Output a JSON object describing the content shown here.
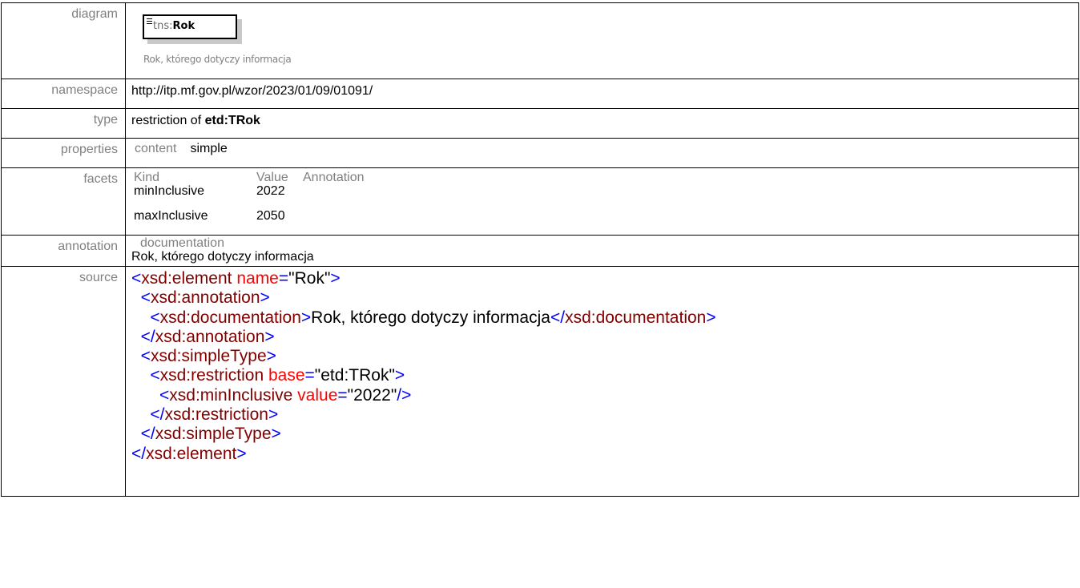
{
  "rows": {
    "diagram": {
      "label": "diagram",
      "box_ns": "tns:",
      "box_name": "Rok",
      "caption": "Rok, którego dotyczy informacja"
    },
    "namespace": {
      "label": "namespace",
      "value": "http://itp.mf.gov.pl/wzor/2023/01/09/01091/"
    },
    "type": {
      "label": "type",
      "prefix": "restriction of ",
      "base": "etd:TRok"
    },
    "properties": {
      "label": "properties",
      "key": "content",
      "value": "simple"
    },
    "facets": {
      "label": "facets",
      "headers": [
        "Kind",
        "Value",
        "Annotation"
      ],
      "items": [
        {
          "kind": "minInclusive",
          "value": "2022",
          "annotation": ""
        },
        {
          "kind": "maxInclusive",
          "value": "2050",
          "annotation": ""
        }
      ]
    },
    "annotation": {
      "label": "annotation",
      "header": "documentation",
      "text": "Rok, którego dotyczy informacja"
    },
    "source": {
      "label": "source",
      "lines": [
        {
          "indent": "",
          "p1": "<",
          "tag": "xsd:element",
          "attr": " name",
          "eq": "=",
          "val": "\"Rok\"",
          "p2": ">",
          "text": "",
          "ctag_open": "",
          "ctag": "",
          "ctag_close": ""
        },
        {
          "indent": "  ",
          "p1": "<",
          "tag": "xsd:annotation",
          "attr": "",
          "eq": "",
          "val": "",
          "p2": ">",
          "text": "",
          "ctag_open": "",
          "ctag": "",
          "ctag_close": ""
        },
        {
          "indent": "    ",
          "p1": "<",
          "tag": "xsd:documentation",
          "attr": "",
          "eq": "",
          "val": "",
          "p2": ">",
          "text": "Rok, którego dotyczy informacja",
          "ctag_open": "</",
          "ctag": "xsd:documentation",
          "ctag_close": ">"
        },
        {
          "indent": "  ",
          "p1": "</",
          "tag": "xsd:annotation",
          "attr": "",
          "eq": "",
          "val": "",
          "p2": ">",
          "text": "",
          "ctag_open": "",
          "ctag": "",
          "ctag_close": ""
        },
        {
          "indent": "  ",
          "p1": "<",
          "tag": "xsd:simpleType",
          "attr": "",
          "eq": "",
          "val": "",
          "p2": ">",
          "text": "",
          "ctag_open": "",
          "ctag": "",
          "ctag_close": ""
        },
        {
          "indent": "    ",
          "p1": "<",
          "tag": "xsd:restriction",
          "attr": " base",
          "eq": "=",
          "val": "\"etd:TRok\"",
          "p2": ">",
          "text": "",
          "ctag_open": "",
          "ctag": "",
          "ctag_close": ""
        },
        {
          "indent": "      ",
          "p1": "<",
          "tag": "xsd:minInclusive",
          "attr": " value",
          "eq": "=",
          "val": "\"2022\"",
          "p2": "/>",
          "text": "",
          "ctag_open": "",
          "ctag": "",
          "ctag_close": ""
        },
        {
          "indent": "    ",
          "p1": "</",
          "tag": "xsd:restriction",
          "attr": "",
          "eq": "",
          "val": "",
          "p2": ">",
          "text": "",
          "ctag_open": "",
          "ctag": "",
          "ctag_close": ""
        },
        {
          "indent": "  ",
          "p1": "</",
          "tag": "xsd:simpleType",
          "attr": "",
          "eq": "",
          "val": "",
          "p2": ">",
          "text": "",
          "ctag_open": "",
          "ctag": "",
          "ctag_close": ""
        },
        {
          "indent": "",
          "p1": "</",
          "tag": "xsd:element",
          "attr": "",
          "eq": "",
          "val": "",
          "p2": ">",
          "text": "",
          "ctag_open": "",
          "ctag": "",
          "ctag_close": ""
        }
      ]
    }
  },
  "colors": {
    "label": "#808080",
    "bracket": "#0000ff",
    "tag": "#800000",
    "attribute": "#ff0000",
    "border": "#000000"
  }
}
